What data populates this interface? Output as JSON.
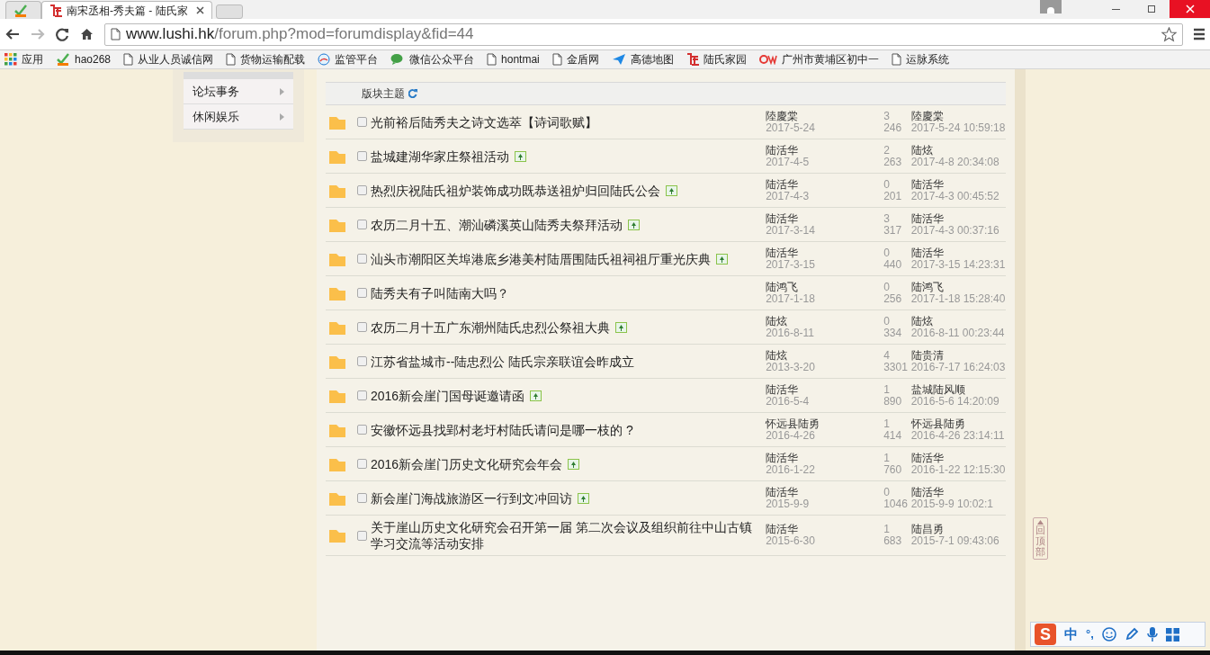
{
  "browser": {
    "tabs": [
      {
        "kind": "hao",
        "selected": false
      },
      {
        "kind": "lu",
        "title": "南宋丞相-秀夫篇 - 陆氏家",
        "selected": true
      }
    ],
    "url_host": "www.lushi.hk",
    "url_path": "/forum.php?mod=forumdisplay&fid=44",
    "bookmarks": [
      {
        "kind": "apps",
        "label": "应用"
      },
      {
        "kind": "hao",
        "label": "hao268"
      },
      {
        "kind": "page",
        "label": "从业人员诚信网"
      },
      {
        "kind": "page",
        "label": "货物运输配载"
      },
      {
        "kind": "globe",
        "label": "监管平台"
      },
      {
        "kind": "chat",
        "label": "微信公众平台"
      },
      {
        "kind": "page",
        "label": "hontmai"
      },
      {
        "kind": "page",
        "label": "金盾网"
      },
      {
        "kind": "plane",
        "label": "高德地图"
      },
      {
        "kind": "lu",
        "label": "陆氏家园"
      },
      {
        "kind": "qw",
        "label": "广州市黄埔区初中一"
      },
      {
        "kind": "page",
        "label": "运脉系统"
      }
    ]
  },
  "sidebar": {
    "items": [
      {
        "label": "论坛事务"
      },
      {
        "label": "休闲娱乐"
      }
    ]
  },
  "thread_list": {
    "header": "版块主题",
    "rows": [
      {
        "title": "光前裕后陆秀夫之诗文选萃【诗词歌赋】",
        "checked": false,
        "has_image": false,
        "author": "陸慶棠",
        "date": "2017-5-24",
        "replies": "3",
        "views": "246",
        "last_user": "陸慶棠",
        "last_time": "2017-5-24 10:59:18"
      },
      {
        "title": "盐城建湖华家庄祭祖活动",
        "checked": false,
        "has_image": true,
        "author": "陆活华",
        "date": "2017-4-5",
        "replies": "2",
        "views": "263",
        "last_user": "陆炫",
        "last_time": "2017-4-8 20:34:08"
      },
      {
        "title": "热烈庆祝陆氏祖炉装饰成功既恭送祖炉归回陆氏公会",
        "checked": false,
        "has_image": true,
        "author": "陆活华",
        "date": "2017-4-3",
        "replies": "0",
        "views": "201",
        "last_user": "陆活华",
        "last_time": "2017-4-3 00:45:52"
      },
      {
        "title": "农历二月十五、潮汕磷溪英山陆秀夫祭拜活动",
        "checked": false,
        "has_image": true,
        "author": "陆活华",
        "date": "2017-3-14",
        "replies": "3",
        "views": "317",
        "last_user": "陆活华",
        "last_time": "2017-4-3 00:37:16"
      },
      {
        "title": "汕头市潮阳区关埠港底乡港美村陆厝围陆氏祖祠祖厅重光庆典",
        "checked": false,
        "has_image": true,
        "author": "陆活华",
        "date": "2017-3-15",
        "replies": "0",
        "views": "440",
        "last_user": "陆活华",
        "last_time": "2017-3-15 14:23:31"
      },
      {
        "title": "陆秀夫有子叫陆南大吗？",
        "checked": false,
        "has_image": false,
        "author": "陆鸿飞",
        "date": "2017-1-18",
        "replies": "0",
        "views": "256",
        "last_user": "陆鸿飞",
        "last_time": "2017-1-18 15:28:40"
      },
      {
        "title": "农历二月十五广东潮州陆氏忠烈公祭祖大典",
        "checked": false,
        "has_image": true,
        "author": "陆炫",
        "date": "2016-8-11",
        "replies": "0",
        "views": "334",
        "last_user": "陆炫",
        "last_time": "2016-8-11 00:23:44"
      },
      {
        "title": "江苏省盐城市--陆忠烈公 陆氏宗亲联谊会昨成立",
        "checked": false,
        "has_image": false,
        "author": "陆炫",
        "date": "2013-3-20",
        "replies": "4",
        "views": "3301",
        "last_user": "陆贵清",
        "last_time": "2016-7-17 16:24:03"
      },
      {
        "title": "2016新会崖门国母诞邀请函",
        "checked": false,
        "has_image": true,
        "author": "陆活华",
        "date": "2016-5-4",
        "replies": "1",
        "views": "890",
        "last_user": "盐城陆风顺",
        "last_time": "2016-5-6 14:20:09"
      },
      {
        "title": "安徽怀远县找郢村老圩村陆氏请问是哪一枝的 ?",
        "checked": false,
        "has_image": false,
        "author": "怀远县陆勇",
        "date": "2016-4-26",
        "replies": "1",
        "views": "414",
        "last_user": "怀远县陆勇",
        "last_time": "2016-4-26 23:14:11"
      },
      {
        "title": "2016新会崖门历史文化研究会年会",
        "checked": false,
        "has_image": true,
        "author": "陆活华",
        "date": "2016-1-22",
        "replies": "1",
        "views": "760",
        "last_user": "陆活华",
        "last_time": "2016-1-22 12:15:30"
      },
      {
        "title": "新会崖门海战旅游区一行到文冲回访",
        "checked": false,
        "has_image": true,
        "author": "陆活华",
        "date": "2015-9-9",
        "replies": "0",
        "views": "1046",
        "last_user": "陆活华",
        "last_time": "2015-9-9 10:02:1"
      },
      {
        "title": "关于崖山历史文化研究会召开第一届 第二次会议及组织前往中山古镇学习交流等活动安排",
        "checked": false,
        "has_image": false,
        "author": "陆活华",
        "date": "2015-6-30",
        "replies": "1",
        "views": "683",
        "last_user": "陆昌勇",
        "last_time": "2015-7-1 09:43:06"
      }
    ]
  },
  "back_to_top": "回顶部",
  "ime": {
    "logo": "S",
    "mode": "中",
    "punct": "°,"
  }
}
